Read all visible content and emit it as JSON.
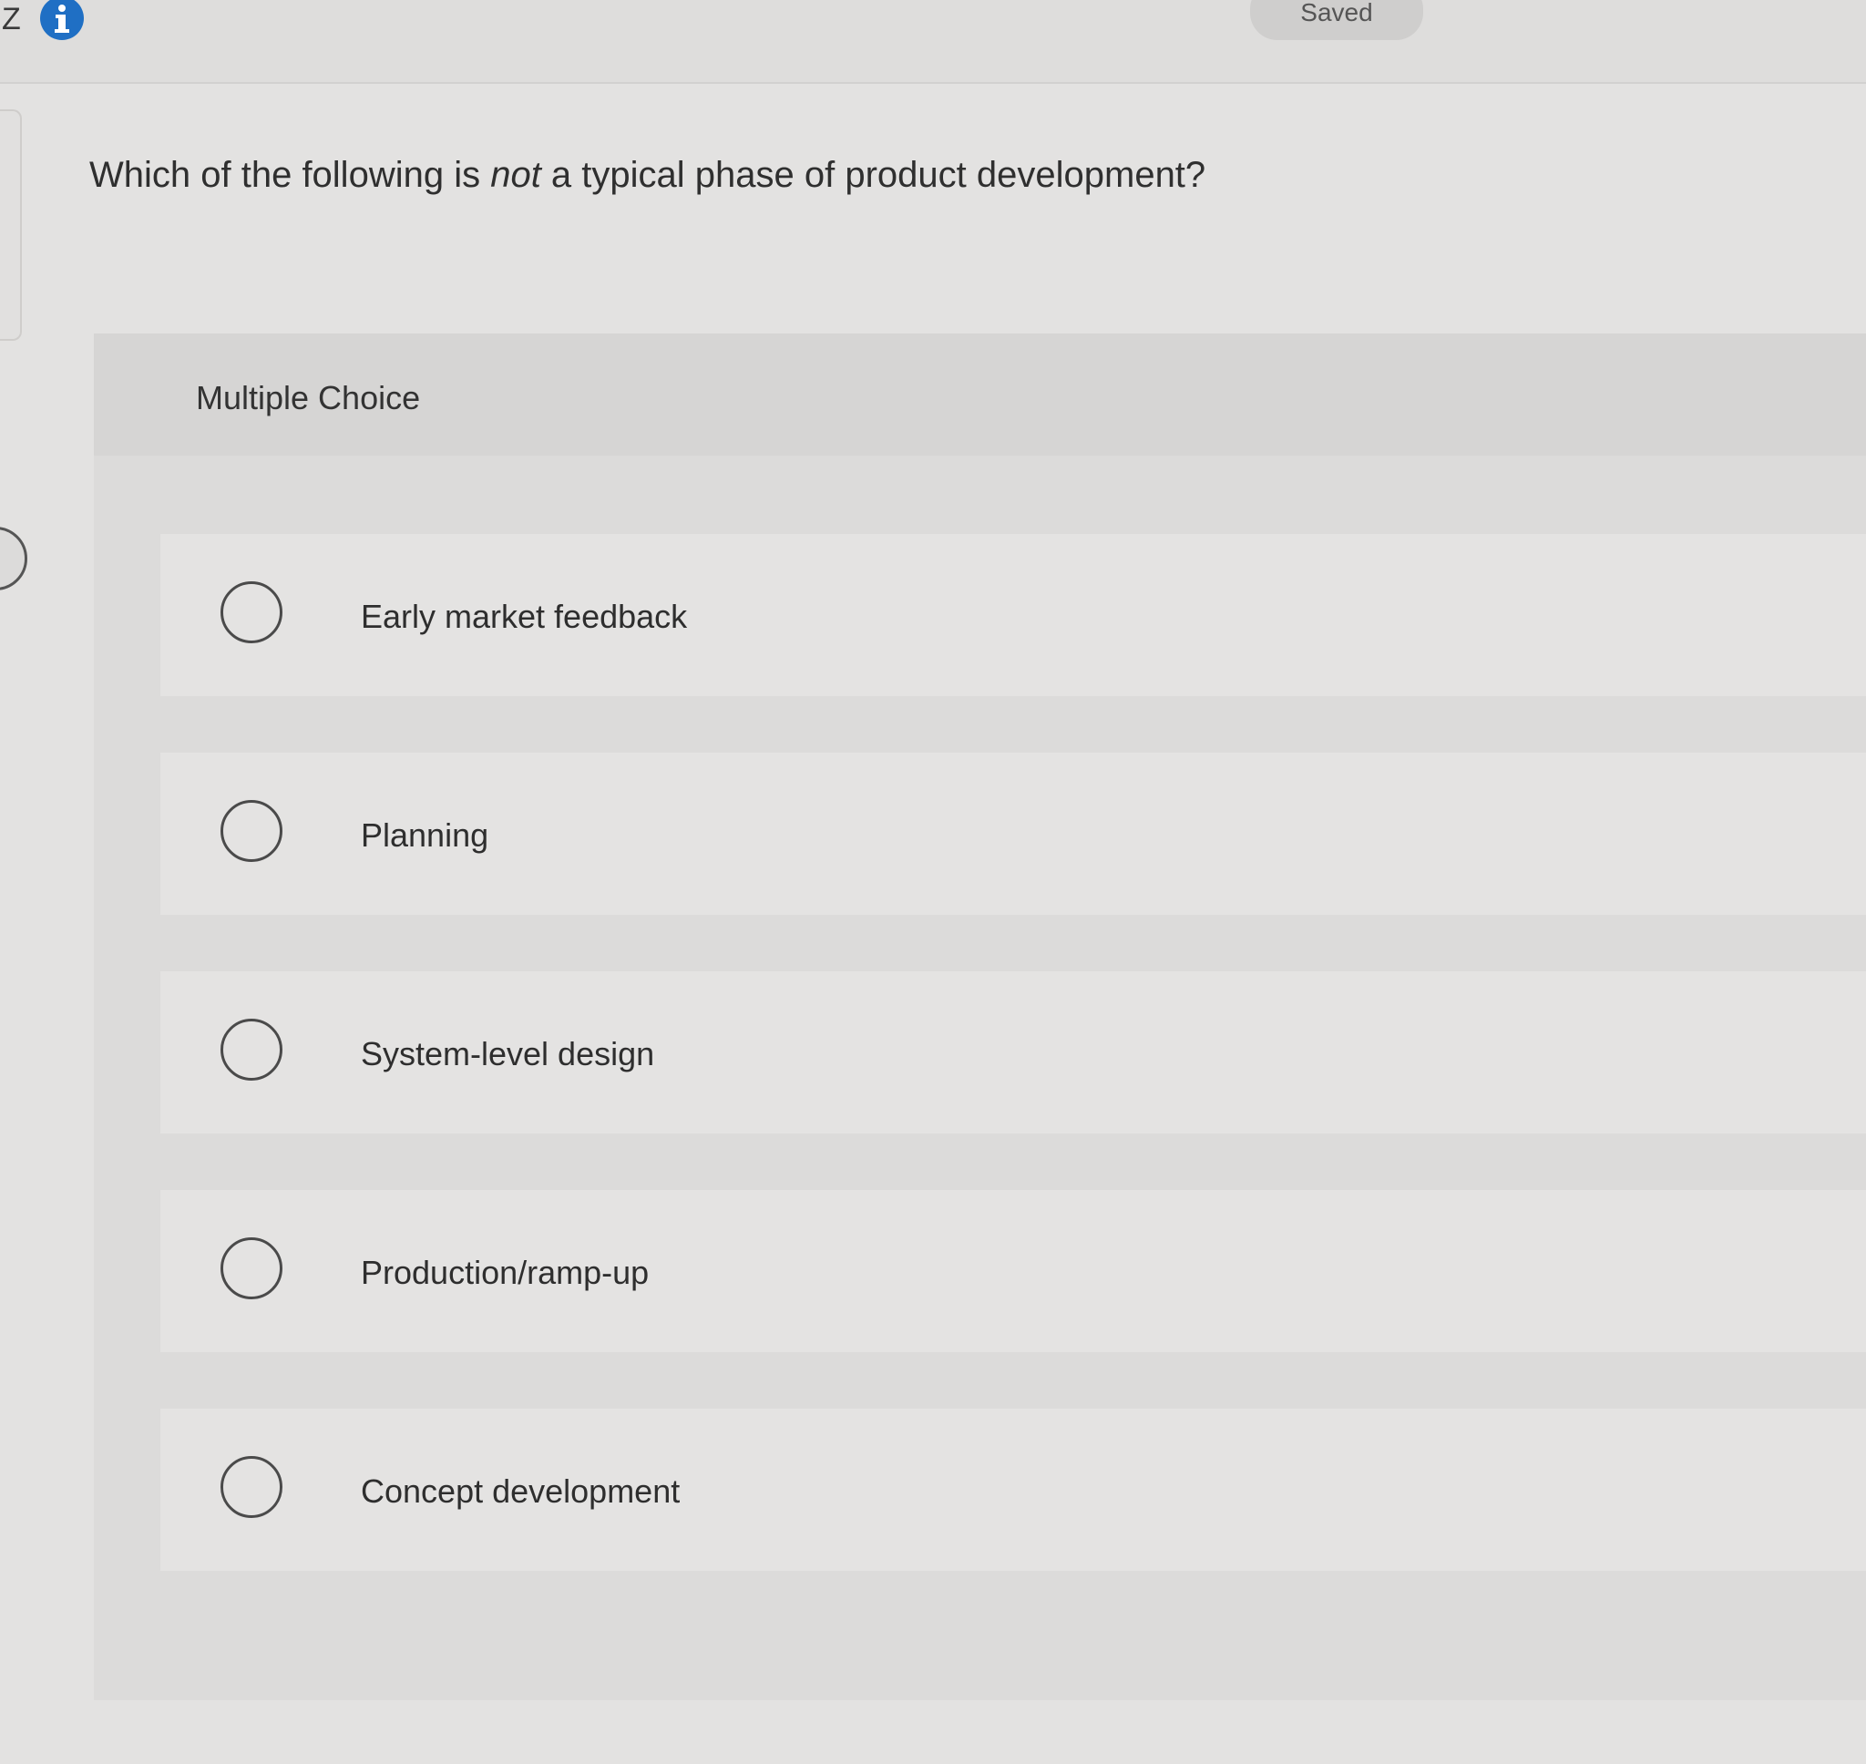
{
  "header": {
    "left_letter": "Z",
    "info_icon": "info-icon",
    "status": "Saved"
  },
  "question": {
    "prefix": "Which of the following is ",
    "emphasis": "not",
    "suffix": " a typical phase of product development?"
  },
  "multiple_choice": {
    "label": "Multiple Choice",
    "options": [
      {
        "label": "Early market feedback"
      },
      {
        "label": "Planning"
      },
      {
        "label": "System-level design"
      },
      {
        "label": "Production/ramp-up"
      },
      {
        "label": "Concept development"
      }
    ]
  },
  "colors": {
    "info_icon_blue": "#1f6fc4",
    "background": "#e3e2e1"
  }
}
